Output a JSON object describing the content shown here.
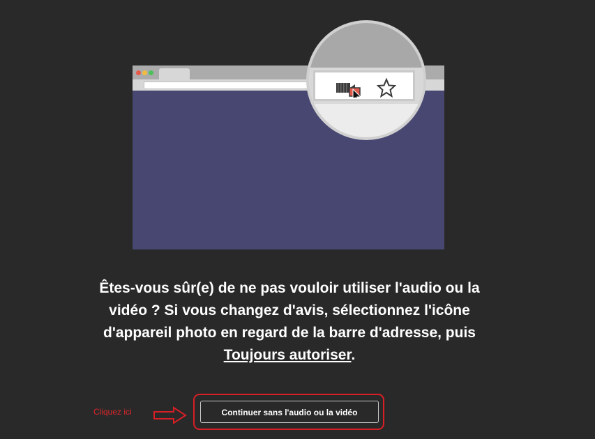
{
  "message": {
    "line1": "Êtes-vous sûr(e) de ne pas vouloir utiliser l'audio ou la",
    "line2": "vidéo ? Si vous changez d'avis, sélectionnez l'icône",
    "line3": "d'appareil photo en regard de la barre d'adresse, puis",
    "link_text": "Toujours autoriser",
    "end_punct": "."
  },
  "annotation": {
    "hint_text": "Cliquez ici"
  },
  "continue_button": {
    "label": "Continuer sans l'audio ou la vidéo"
  },
  "illustration": {
    "icons": [
      "camera-blocked-icon",
      "star-icon",
      "cursor-icon"
    ]
  },
  "colors": {
    "background": "#292929",
    "browser_body": "#474772",
    "annotation_red": "#d71f26",
    "blocked_red": "#e0594b"
  }
}
